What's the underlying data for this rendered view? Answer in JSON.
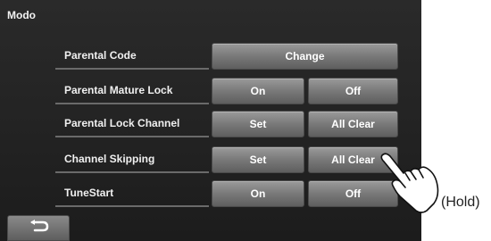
{
  "title": "Modo",
  "rows": [
    {
      "label": "Parental Code",
      "buttons": [
        "Change"
      ]
    },
    {
      "label": "Parental Mature Lock",
      "buttons": [
        "On",
        "Off"
      ]
    },
    {
      "label": "Parental Lock Channel",
      "buttons": [
        "Set",
        "All Clear"
      ]
    },
    {
      "label": "Channel Skipping",
      "buttons": [
        "Set",
        "All Clear"
      ]
    },
    {
      "label": "TuneStart",
      "buttons": [
        "On",
        "Off"
      ]
    }
  ],
  "back_icon": "return-arrow-icon",
  "hold_label": "(Hold)",
  "colors": {
    "screen_bg": "#222222",
    "button": "#7c7c7c",
    "text": "#ffffff"
  }
}
